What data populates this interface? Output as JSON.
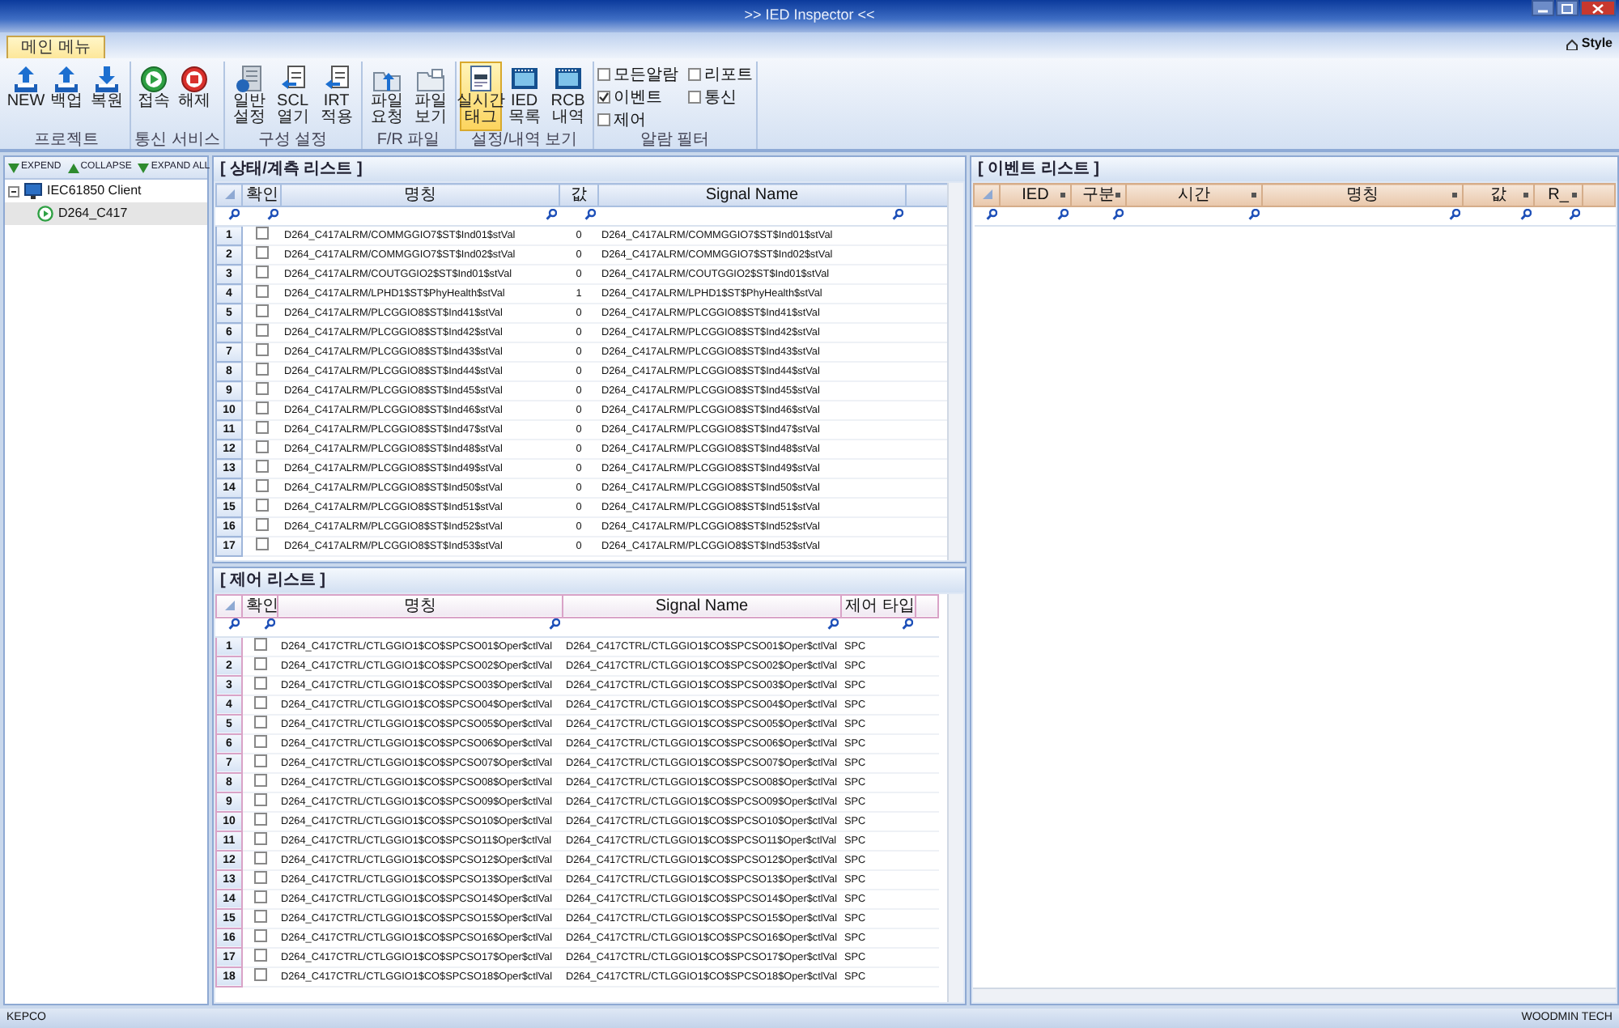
{
  "window": {
    "title": ">> IED Inspector <<"
  },
  "ribbon": {
    "tabs": [
      {
        "label": "메인 메뉴",
        "selected": true
      }
    ],
    "style_menu": "Style",
    "groups": [
      {
        "label": "프로젝트",
        "buttons": [
          {
            "label": "NEW",
            "kind": "upload",
            "selected": false
          },
          {
            "label": "백업",
            "kind": "upload",
            "selected": false
          },
          {
            "label": "복원",
            "kind": "download",
            "selected": false
          }
        ]
      },
      {
        "label": "통신 서비스",
        "buttons": [
          {
            "label": "접속",
            "kind": "play",
            "selected": false
          },
          {
            "label": "해제",
            "kind": "stop",
            "selected": false
          }
        ]
      },
      {
        "label": "구성 설정",
        "buttons": [
          {
            "label": "일반 설정",
            "kind": "database",
            "selected": false
          },
          {
            "label": "SCL 열기",
            "kind": "doc-arrow",
            "selected": false
          },
          {
            "label": "IRT 적용",
            "kind": "doc-arrow",
            "selected": false
          }
        ]
      },
      {
        "label": "F/R 파일",
        "buttons": [
          {
            "label": "파일 요청",
            "kind": "folder-arrow",
            "selected": false
          },
          {
            "label": "파일 보기",
            "kind": "folder",
            "selected": false
          }
        ]
      },
      {
        "label": "설정/내역 보기",
        "buttons": [
          {
            "label": "실시간 태그",
            "kind": "tag",
            "selected": true
          },
          {
            "label": "IED 목록",
            "kind": "film",
            "selected": false
          },
          {
            "label": "RCB 내역",
            "kind": "film",
            "selected": false
          }
        ]
      }
    ],
    "alarm_filter": {
      "label": "알람 필터",
      "options": [
        {
          "label": "모든알람",
          "checked": false
        },
        {
          "label": "이벤트",
          "checked": true
        },
        {
          "label": "제어",
          "checked": false
        },
        {
          "label": "리포트",
          "checked": false
        },
        {
          "label": "통신",
          "checked": false
        }
      ]
    }
  },
  "tree": {
    "toolbar": [
      {
        "label": "EXPEND",
        "kind": "down"
      },
      {
        "label": "COLLAPSE",
        "kind": "up"
      },
      {
        "label": "EXPAND ALL",
        "kind": "down"
      }
    ],
    "nodes": [
      {
        "label": "IEC61850 Client",
        "kind": "computer",
        "expanded": true,
        "selected": false,
        "children": [
          {
            "label": "D264_C417",
            "kind": "device",
            "selected": true
          }
        ]
      }
    ]
  },
  "status_list": {
    "title": "[ 상태/계측 리스트 ]",
    "columns": [
      "확인",
      "명칭",
      "값",
      "Signal Name"
    ],
    "rows": [
      {
        "no": "1",
        "checked": false,
        "name": "D264_C417ALRM/COMMGGIO7$ST$Ind01$stVal",
        "value": "0",
        "signal": "D264_C417ALRM/COMMGGIO7$ST$Ind01$stVal"
      },
      {
        "no": "2",
        "checked": false,
        "name": "D264_C417ALRM/COMMGGIO7$ST$Ind02$stVal",
        "value": "0",
        "signal": "D264_C417ALRM/COMMGGIO7$ST$Ind02$stVal"
      },
      {
        "no": "3",
        "checked": false,
        "name": "D264_C417ALRM/COUTGGIO2$ST$Ind01$stVal",
        "value": "0",
        "signal": "D264_C417ALRM/COUTGGIO2$ST$Ind01$stVal"
      },
      {
        "no": "4",
        "checked": false,
        "name": "D264_C417ALRM/LPHD1$ST$PhyHealth$stVal",
        "value": "1",
        "signal": "D264_C417ALRM/LPHD1$ST$PhyHealth$stVal"
      },
      {
        "no": "5",
        "checked": false,
        "name": "D264_C417ALRM/PLCGGIO8$ST$Ind41$stVal",
        "value": "0",
        "signal": "D264_C417ALRM/PLCGGIO8$ST$Ind41$stVal"
      },
      {
        "no": "6",
        "checked": false,
        "name": "D264_C417ALRM/PLCGGIO8$ST$Ind42$stVal",
        "value": "0",
        "signal": "D264_C417ALRM/PLCGGIO8$ST$Ind42$stVal"
      },
      {
        "no": "7",
        "checked": false,
        "name": "D264_C417ALRM/PLCGGIO8$ST$Ind43$stVal",
        "value": "0",
        "signal": "D264_C417ALRM/PLCGGIO8$ST$Ind43$stVal"
      },
      {
        "no": "8",
        "checked": false,
        "name": "D264_C417ALRM/PLCGGIO8$ST$Ind44$stVal",
        "value": "0",
        "signal": "D264_C417ALRM/PLCGGIO8$ST$Ind44$stVal"
      },
      {
        "no": "9",
        "checked": false,
        "name": "D264_C417ALRM/PLCGGIO8$ST$Ind45$stVal",
        "value": "0",
        "signal": "D264_C417ALRM/PLCGGIO8$ST$Ind45$stVal"
      },
      {
        "no": "10",
        "checked": false,
        "name": "D264_C417ALRM/PLCGGIO8$ST$Ind46$stVal",
        "value": "0",
        "signal": "D264_C417ALRM/PLCGGIO8$ST$Ind46$stVal"
      },
      {
        "no": "11",
        "checked": false,
        "name": "D264_C417ALRM/PLCGGIO8$ST$Ind47$stVal",
        "value": "0",
        "signal": "D264_C417ALRM/PLCGGIO8$ST$Ind47$stVal"
      },
      {
        "no": "12",
        "checked": false,
        "name": "D264_C417ALRM/PLCGGIO8$ST$Ind48$stVal",
        "value": "0",
        "signal": "D264_C417ALRM/PLCGGIO8$ST$Ind48$stVal"
      },
      {
        "no": "13",
        "checked": false,
        "name": "D264_C417ALRM/PLCGGIO8$ST$Ind49$stVal",
        "value": "0",
        "signal": "D264_C417ALRM/PLCGGIO8$ST$Ind49$stVal"
      },
      {
        "no": "14",
        "checked": false,
        "name": "D264_C417ALRM/PLCGGIO8$ST$Ind50$stVal",
        "value": "0",
        "signal": "D264_C417ALRM/PLCGGIO8$ST$Ind50$stVal"
      },
      {
        "no": "15",
        "checked": false,
        "name": "D264_C417ALRM/PLCGGIO8$ST$Ind51$stVal",
        "value": "0",
        "signal": "D264_C417ALRM/PLCGGIO8$ST$Ind51$stVal"
      },
      {
        "no": "16",
        "checked": false,
        "name": "D264_C417ALRM/PLCGGIO8$ST$Ind52$stVal",
        "value": "0",
        "signal": "D264_C417ALRM/PLCGGIO8$ST$Ind52$stVal"
      },
      {
        "no": "17",
        "checked": false,
        "name": "D264_C417ALRM/PLCGGIO8$ST$Ind53$stVal",
        "value": "0",
        "signal": "D264_C417ALRM/PLCGGIO8$ST$Ind53$stVal"
      }
    ]
  },
  "control_list": {
    "title": "[ 제어 리스트 ]",
    "columns": [
      "확인",
      "명칭",
      "Signal Name",
      "제어 타입"
    ],
    "rows": [
      {
        "no": "1",
        "checked": false,
        "name": "D264_C417CTRL/CTLGGIO1$CO$SPCSO01$Oper$ctlVal",
        "signal": "D264_C417CTRL/CTLGGIO1$CO$SPCSO01$Oper$ctlVal",
        "type": "SPC"
      },
      {
        "no": "2",
        "checked": false,
        "name": "D264_C417CTRL/CTLGGIO1$CO$SPCSO02$Oper$ctlVal",
        "signal": "D264_C417CTRL/CTLGGIO1$CO$SPCSO02$Oper$ctlVal",
        "type": "SPC"
      },
      {
        "no": "3",
        "checked": false,
        "name": "D264_C417CTRL/CTLGGIO1$CO$SPCSO03$Oper$ctlVal",
        "signal": "D264_C417CTRL/CTLGGIO1$CO$SPCSO03$Oper$ctlVal",
        "type": "SPC"
      },
      {
        "no": "4",
        "checked": false,
        "name": "D264_C417CTRL/CTLGGIO1$CO$SPCSO04$Oper$ctlVal",
        "signal": "D264_C417CTRL/CTLGGIO1$CO$SPCSO04$Oper$ctlVal",
        "type": "SPC"
      },
      {
        "no": "5",
        "checked": false,
        "name": "D264_C417CTRL/CTLGGIO1$CO$SPCSO05$Oper$ctlVal",
        "signal": "D264_C417CTRL/CTLGGIO1$CO$SPCSO05$Oper$ctlVal",
        "type": "SPC"
      },
      {
        "no": "6",
        "checked": false,
        "name": "D264_C417CTRL/CTLGGIO1$CO$SPCSO06$Oper$ctlVal",
        "signal": "D264_C417CTRL/CTLGGIO1$CO$SPCSO06$Oper$ctlVal",
        "type": "SPC"
      },
      {
        "no": "7",
        "checked": false,
        "name": "D264_C417CTRL/CTLGGIO1$CO$SPCSO07$Oper$ctlVal",
        "signal": "D264_C417CTRL/CTLGGIO1$CO$SPCSO07$Oper$ctlVal",
        "type": "SPC"
      },
      {
        "no": "8",
        "checked": false,
        "name": "D264_C417CTRL/CTLGGIO1$CO$SPCSO08$Oper$ctlVal",
        "signal": "D264_C417CTRL/CTLGGIO1$CO$SPCSO08$Oper$ctlVal",
        "type": "SPC"
      },
      {
        "no": "9",
        "checked": false,
        "name": "D264_C417CTRL/CTLGGIO1$CO$SPCSO09$Oper$ctlVal",
        "signal": "D264_C417CTRL/CTLGGIO1$CO$SPCSO09$Oper$ctlVal",
        "type": "SPC"
      },
      {
        "no": "10",
        "checked": false,
        "name": "D264_C417CTRL/CTLGGIO1$CO$SPCSO10$Oper$ctlVal",
        "signal": "D264_C417CTRL/CTLGGIO1$CO$SPCSO10$Oper$ctlVal",
        "type": "SPC"
      },
      {
        "no": "11",
        "checked": false,
        "name": "D264_C417CTRL/CTLGGIO1$CO$SPCSO11$Oper$ctlVal",
        "signal": "D264_C417CTRL/CTLGGIO1$CO$SPCSO11$Oper$ctlVal",
        "type": "SPC"
      },
      {
        "no": "12",
        "checked": false,
        "name": "D264_C417CTRL/CTLGGIO1$CO$SPCSO12$Oper$ctlVal",
        "signal": "D264_C417CTRL/CTLGGIO1$CO$SPCSO12$Oper$ctlVal",
        "type": "SPC"
      },
      {
        "no": "13",
        "checked": false,
        "name": "D264_C417CTRL/CTLGGIO1$CO$SPCSO13$Oper$ctlVal",
        "signal": "D264_C417CTRL/CTLGGIO1$CO$SPCSO13$Oper$ctlVal",
        "type": "SPC"
      },
      {
        "no": "14",
        "checked": false,
        "name": "D264_C417CTRL/CTLGGIO1$CO$SPCSO14$Oper$ctlVal",
        "signal": "D264_C417CTRL/CTLGGIO1$CO$SPCSO14$Oper$ctlVal",
        "type": "SPC"
      },
      {
        "no": "15",
        "checked": false,
        "name": "D264_C417CTRL/CTLGGIO1$CO$SPCSO15$Oper$ctlVal",
        "signal": "D264_C417CTRL/CTLGGIO1$CO$SPCSO15$Oper$ctlVal",
        "type": "SPC"
      },
      {
        "no": "16",
        "checked": false,
        "name": "D264_C417CTRL/CTLGGIO1$CO$SPCSO16$Oper$ctlVal",
        "signal": "D264_C417CTRL/CTLGGIO1$CO$SPCSO16$Oper$ctlVal",
        "type": "SPC"
      },
      {
        "no": "17",
        "checked": false,
        "name": "D264_C417CTRL/CTLGGIO1$CO$SPCSO17$Oper$ctlVal",
        "signal": "D264_C417CTRL/CTLGGIO1$CO$SPCSO17$Oper$ctlVal",
        "type": "SPC"
      },
      {
        "no": "18",
        "checked": false,
        "name": "D264_C417CTRL/CTLGGIO1$CO$SPCSO18$Oper$ctlVal",
        "signal": "D264_C417CTRL/CTLGGIO1$CO$SPCSO18$Oper$ctlVal",
        "type": "SPC"
      }
    ]
  },
  "event_list": {
    "title": "[ 이벤트 리스트 ]",
    "columns": [
      "IED",
      "구분",
      "시간",
      "명칭",
      "값",
      "R_"
    ]
  },
  "status_bar": {
    "left": "KEPCO",
    "right": "WOODMIN TECH"
  }
}
